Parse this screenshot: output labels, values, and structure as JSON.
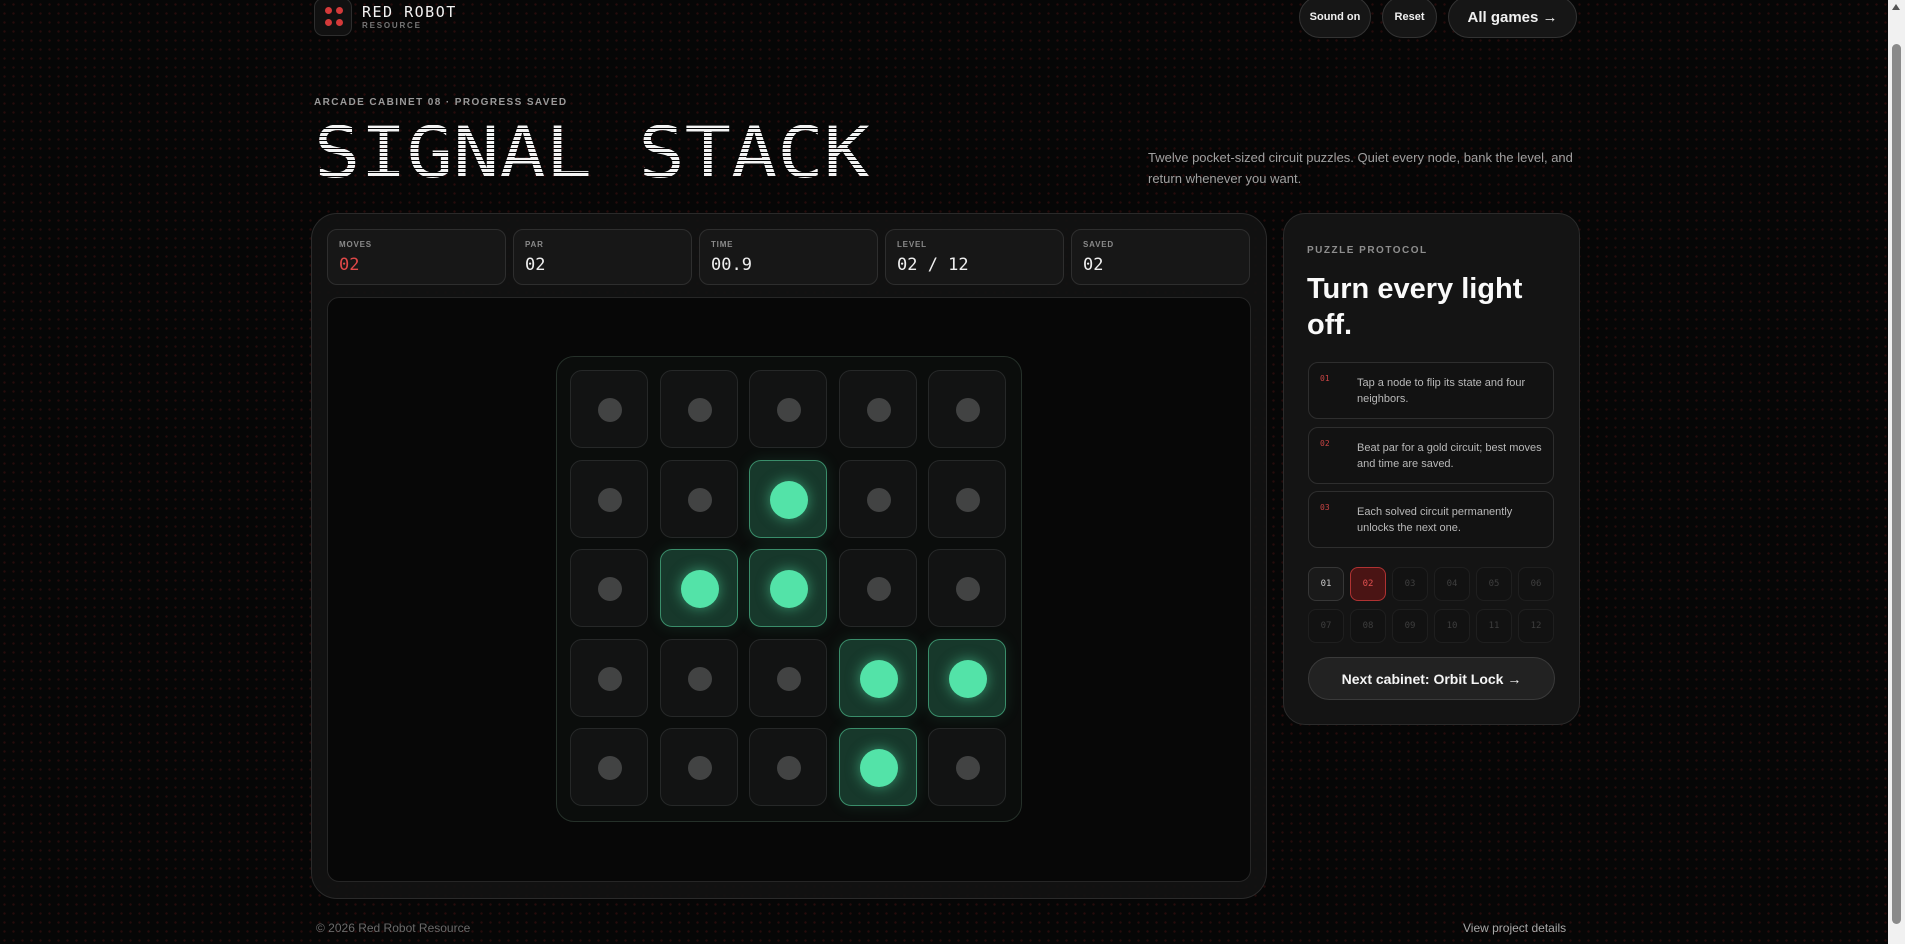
{
  "brand": {
    "name": "RED ROBOT",
    "sub": "RESOURCE"
  },
  "header": {
    "sound_label": "Sound on",
    "reset_label": "Reset",
    "all_games_label": "All games →"
  },
  "hero": {
    "kicker": "ARCADE CABINET 08 · PROGRESS SAVED",
    "title": "SIGNAL STACK",
    "tagline": "Twelve pocket-sized circuit puzzles. Quiet every node, bank the level, and return whenever you want."
  },
  "stats": [
    {
      "label": "MOVES",
      "value": "02"
    },
    {
      "label": "PAR",
      "value": "02"
    },
    {
      "label": "TIME",
      "value": "00.9"
    },
    {
      "label": "LEVEL",
      "value": "02 / 12"
    },
    {
      "label": "SAVED",
      "value": "02"
    }
  ],
  "board": {
    "size": 5,
    "cells": [
      [
        0,
        0,
        0,
        0,
        0
      ],
      [
        0,
        0,
        1,
        0,
        0
      ],
      [
        0,
        1,
        1,
        0,
        0
      ],
      [
        0,
        0,
        0,
        1,
        1
      ],
      [
        0,
        0,
        0,
        1,
        0
      ]
    ],
    "on_color": "#53e3a8",
    "off_color": "#424343"
  },
  "protocol": {
    "kicker": "PUZZLE PROTOCOL",
    "heading": "Turn every light off.",
    "steps": [
      {
        "num": "01",
        "text": "Tap a node to flip its state and four neighbors."
      },
      {
        "num": "02",
        "text": "Beat par for a gold circuit; best moves and time are saved."
      },
      {
        "num": "03",
        "text": "Each solved circuit permanently unlocks the next one."
      }
    ],
    "levels": [
      "01",
      "02",
      "03",
      "04",
      "05",
      "06",
      "07",
      "08",
      "09",
      "10",
      "11",
      "12"
    ],
    "current_level": "02",
    "unlocked_levels": [
      "01",
      "02"
    ],
    "next_label": "Next cabinet: Orbit Lock →"
  },
  "footer": {
    "copyright": "© 2026 Red Robot Resource",
    "details_link": "View project details"
  },
  "colors": {
    "accent_red": "#d43a3a",
    "accent_green": "#53e3a8",
    "background": "#060606"
  }
}
